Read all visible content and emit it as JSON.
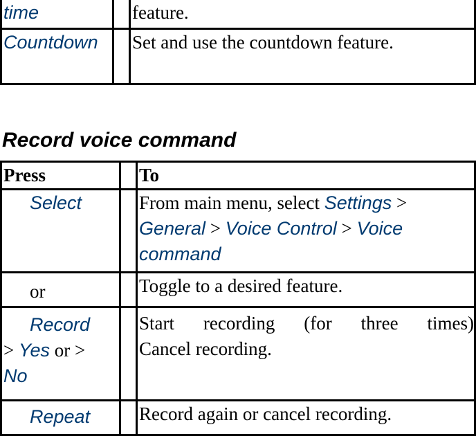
{
  "table1": {
    "rows": [
      {
        "key": "time",
        "desc": "feature."
      },
      {
        "key": "Countdown",
        "desc": "Set and use the countdown feature."
      }
    ]
  },
  "section_title": "Record voice command",
  "table2": {
    "headers": {
      "press": "Press",
      "to": "To"
    },
    "row1": {
      "press": "Select",
      "desc_pre": "From main menu, select ",
      "p1": "Settings",
      "sep": " > ",
      "p2": "General",
      "p3": "Voice Control",
      "p4": "Voice command"
    },
    "row2": {
      "press": "or",
      "desc": "Toggle to a desired feature."
    },
    "row3": {
      "press_key": "Record",
      "gt": "> ",
      "yes": "Yes",
      "or": " or > ",
      "no": "No",
      "line1": "Start recording (for three times)",
      "line2": "Cancel recording."
    },
    "row4": {
      "press": "Repeat",
      "desc": "Record again or cancel recording."
    }
  },
  "colors": {
    "keyword": "#003a70",
    "border": "#000000"
  }
}
